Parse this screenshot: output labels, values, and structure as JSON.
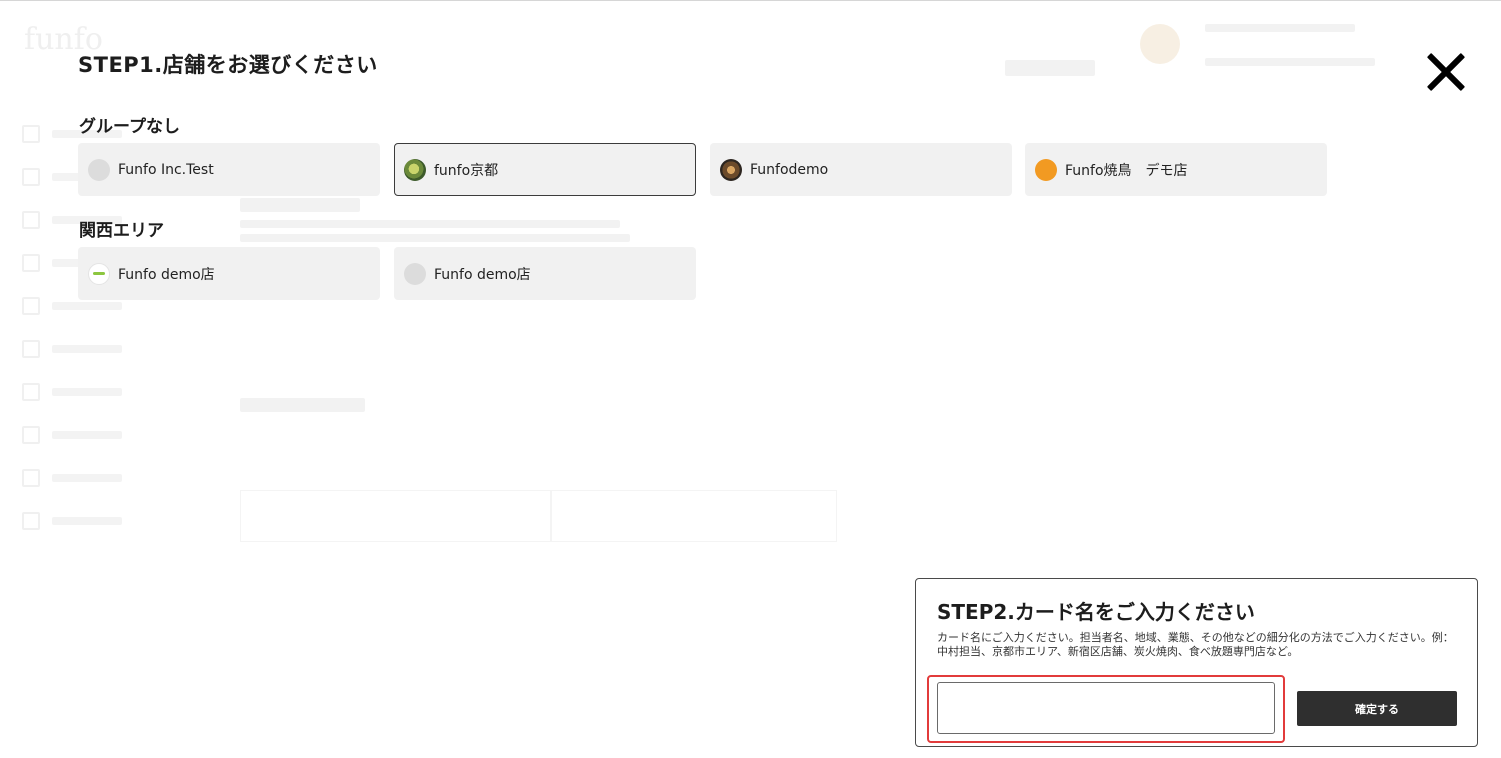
{
  "step1": {
    "title": "STEP1.店舗をお選びください",
    "groups": [
      {
        "name": "グループなし",
        "stores": [
          {
            "label": "Funfo Inc.Test",
            "thumb": "grey",
            "selected": false
          },
          {
            "label": "funfo京都",
            "thumb": "food1",
            "selected": true
          },
          {
            "label": "Funfodemo",
            "thumb": "food2",
            "selected": false
          },
          {
            "label": "Funfo焼鳥　デモ店",
            "thumb": "orange",
            "selected": false
          }
        ]
      },
      {
        "name": "関西エリア",
        "stores": [
          {
            "label": "Funfo demo店",
            "thumb": "green",
            "selected": false
          },
          {
            "label": "Funfo demo店",
            "thumb": "grey",
            "selected": false
          }
        ]
      }
    ]
  },
  "step2": {
    "title": "STEP2.カード名をご入力ください",
    "description": "カード名にご入力ください。担当者名、地域、業態、その他などの細分化の方法でご入力ください。例：中村担当、京都市エリア、新宿区店舗、炭火焼肉、食べ放題専門店など。",
    "input_value": "",
    "input_placeholder": "",
    "confirm_label": "確定する"
  },
  "icons": {
    "close": "close-icon"
  },
  "colors": {
    "highlight": "#e23b3b",
    "confirm_bg": "#2f2f2f",
    "card_bg": "#f1f1f1"
  }
}
